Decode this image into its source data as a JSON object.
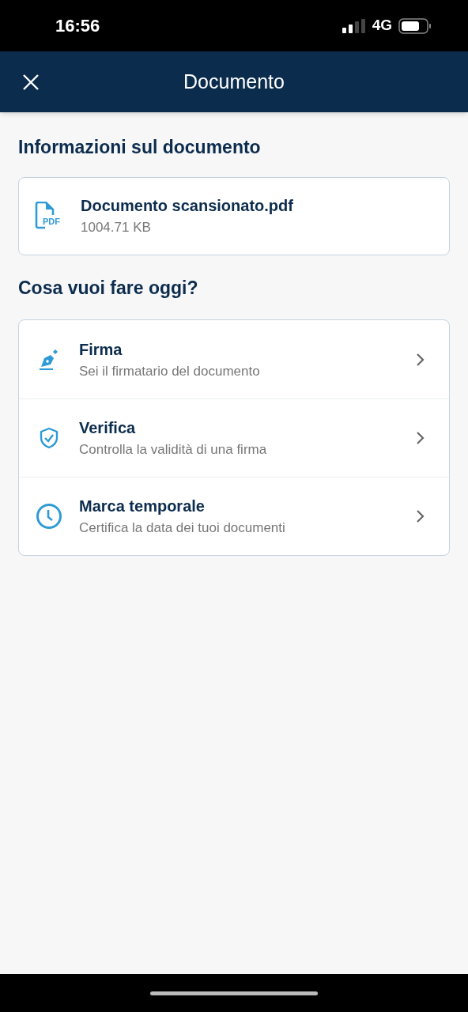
{
  "status_bar": {
    "time": "16:56",
    "network": "4G"
  },
  "header": {
    "title": "Documento"
  },
  "document_section": {
    "heading": "Informazioni sul documento",
    "file": {
      "icon_label": "PDF",
      "name": "Documento scansionato.pdf",
      "size": "1004.71 KB"
    }
  },
  "actions_section": {
    "heading": "Cosa vuoi fare oggi?",
    "items": [
      {
        "kind": "sign",
        "title": "Firma",
        "subtitle": "Sei il firmatario del documento"
      },
      {
        "kind": "verify",
        "title": "Verifica",
        "subtitle": "Controlla la validità di una firma"
      },
      {
        "kind": "timestamp",
        "title": "Marca temporale",
        "subtitle": "Certifica la data dei tuoi documenti"
      }
    ]
  }
}
